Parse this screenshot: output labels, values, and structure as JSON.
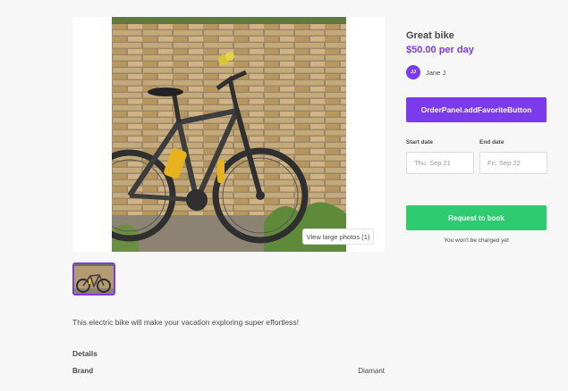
{
  "listing": {
    "title": "Great bike",
    "price": "$50.00 per day",
    "description": "This electric bike will make your vacation exploring super effortless!",
    "author": {
      "initials": "JJ",
      "name": "Jane J"
    }
  },
  "gallery": {
    "view_photos_label": "View large photos (1)"
  },
  "details": {
    "heading": "Details",
    "rows": [
      {
        "label": "Brand",
        "value": "Diamant"
      }
    ]
  },
  "order_panel": {
    "favorite_button_label": "OrderPanel.addFavoriteButton",
    "start_date_label": "Start date",
    "start_date_value": "Thu, Sep 21",
    "end_date_label": "End date",
    "end_date_value": "Fri, Sep 22",
    "book_button_label": "Request to book",
    "no_charge_note": "You won't be charged yet"
  },
  "colors": {
    "accent": "#7c3aed",
    "success": "#2ecc71",
    "background": "#f7f7f7"
  }
}
